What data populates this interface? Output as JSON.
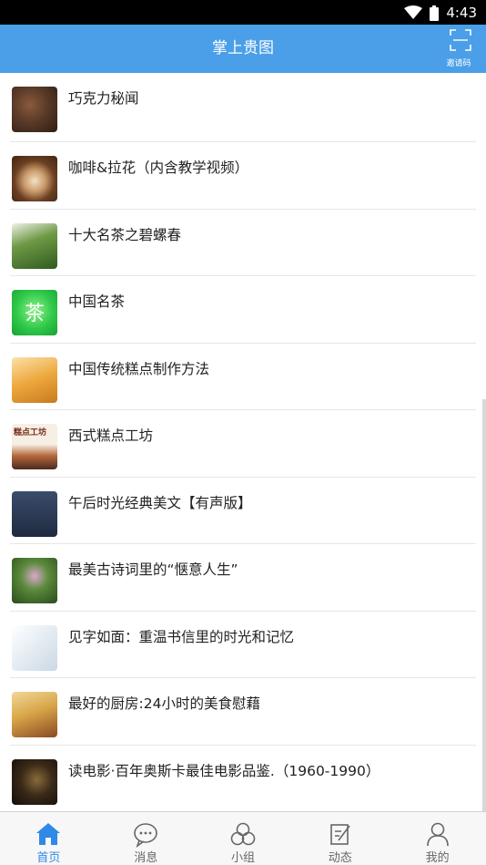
{
  "status_bar": {
    "time": "4:43"
  },
  "header": {
    "title": "掌上贵图",
    "scan_label": "邀请码",
    "scan_icon": "scan-icon"
  },
  "list": {
    "items": [
      {
        "title": "巧克力秘闻",
        "thumb": "#5a3a28"
      },
      {
        "title": "咖啡&拉花（内含教学视频）",
        "thumb": "#6b3f22"
      },
      {
        "title": "十大名茶之碧螺春",
        "thumb": "#3d6b2a"
      },
      {
        "title": "中国名茶",
        "thumb": "#2fc84a",
        "thumb_text": "茶"
      },
      {
        "title": "中国传统糕点制作方法",
        "thumb": "#e8a13a"
      },
      {
        "title": "西式糕点工坊",
        "thumb": "#f1e6d6",
        "thumb_text": "糕点工坊"
      },
      {
        "title": "午后时光经典美文【有声版】",
        "thumb": "#2b3a55"
      },
      {
        "title": "最美古诗词里的“惬意人生”",
        "thumb": "#3b6b2e"
      },
      {
        "title": "见字如面：重温书信里的时光和记忆",
        "thumb": "#e9eef2"
      },
      {
        "title": "最好的厨房:24小时的美食慰藉",
        "thumb": "#d9a64a"
      },
      {
        "title": "读电影·百年奥斯卡最佳电影品鉴.（1960-1990）",
        "thumb": "#1f1a12"
      }
    ]
  },
  "tabbar": {
    "tabs": [
      {
        "label": "首页",
        "icon": "home-icon",
        "active": true
      },
      {
        "label": "消息",
        "icon": "message-icon",
        "active": false
      },
      {
        "label": "小组",
        "icon": "group-icon",
        "active": false
      },
      {
        "label": "动态",
        "icon": "feed-icon",
        "active": false
      },
      {
        "label": "我的",
        "icon": "profile-icon",
        "active": false
      }
    ]
  },
  "colors": {
    "accent": "#4a9fe8",
    "tab_active": "#2e8ae6"
  }
}
